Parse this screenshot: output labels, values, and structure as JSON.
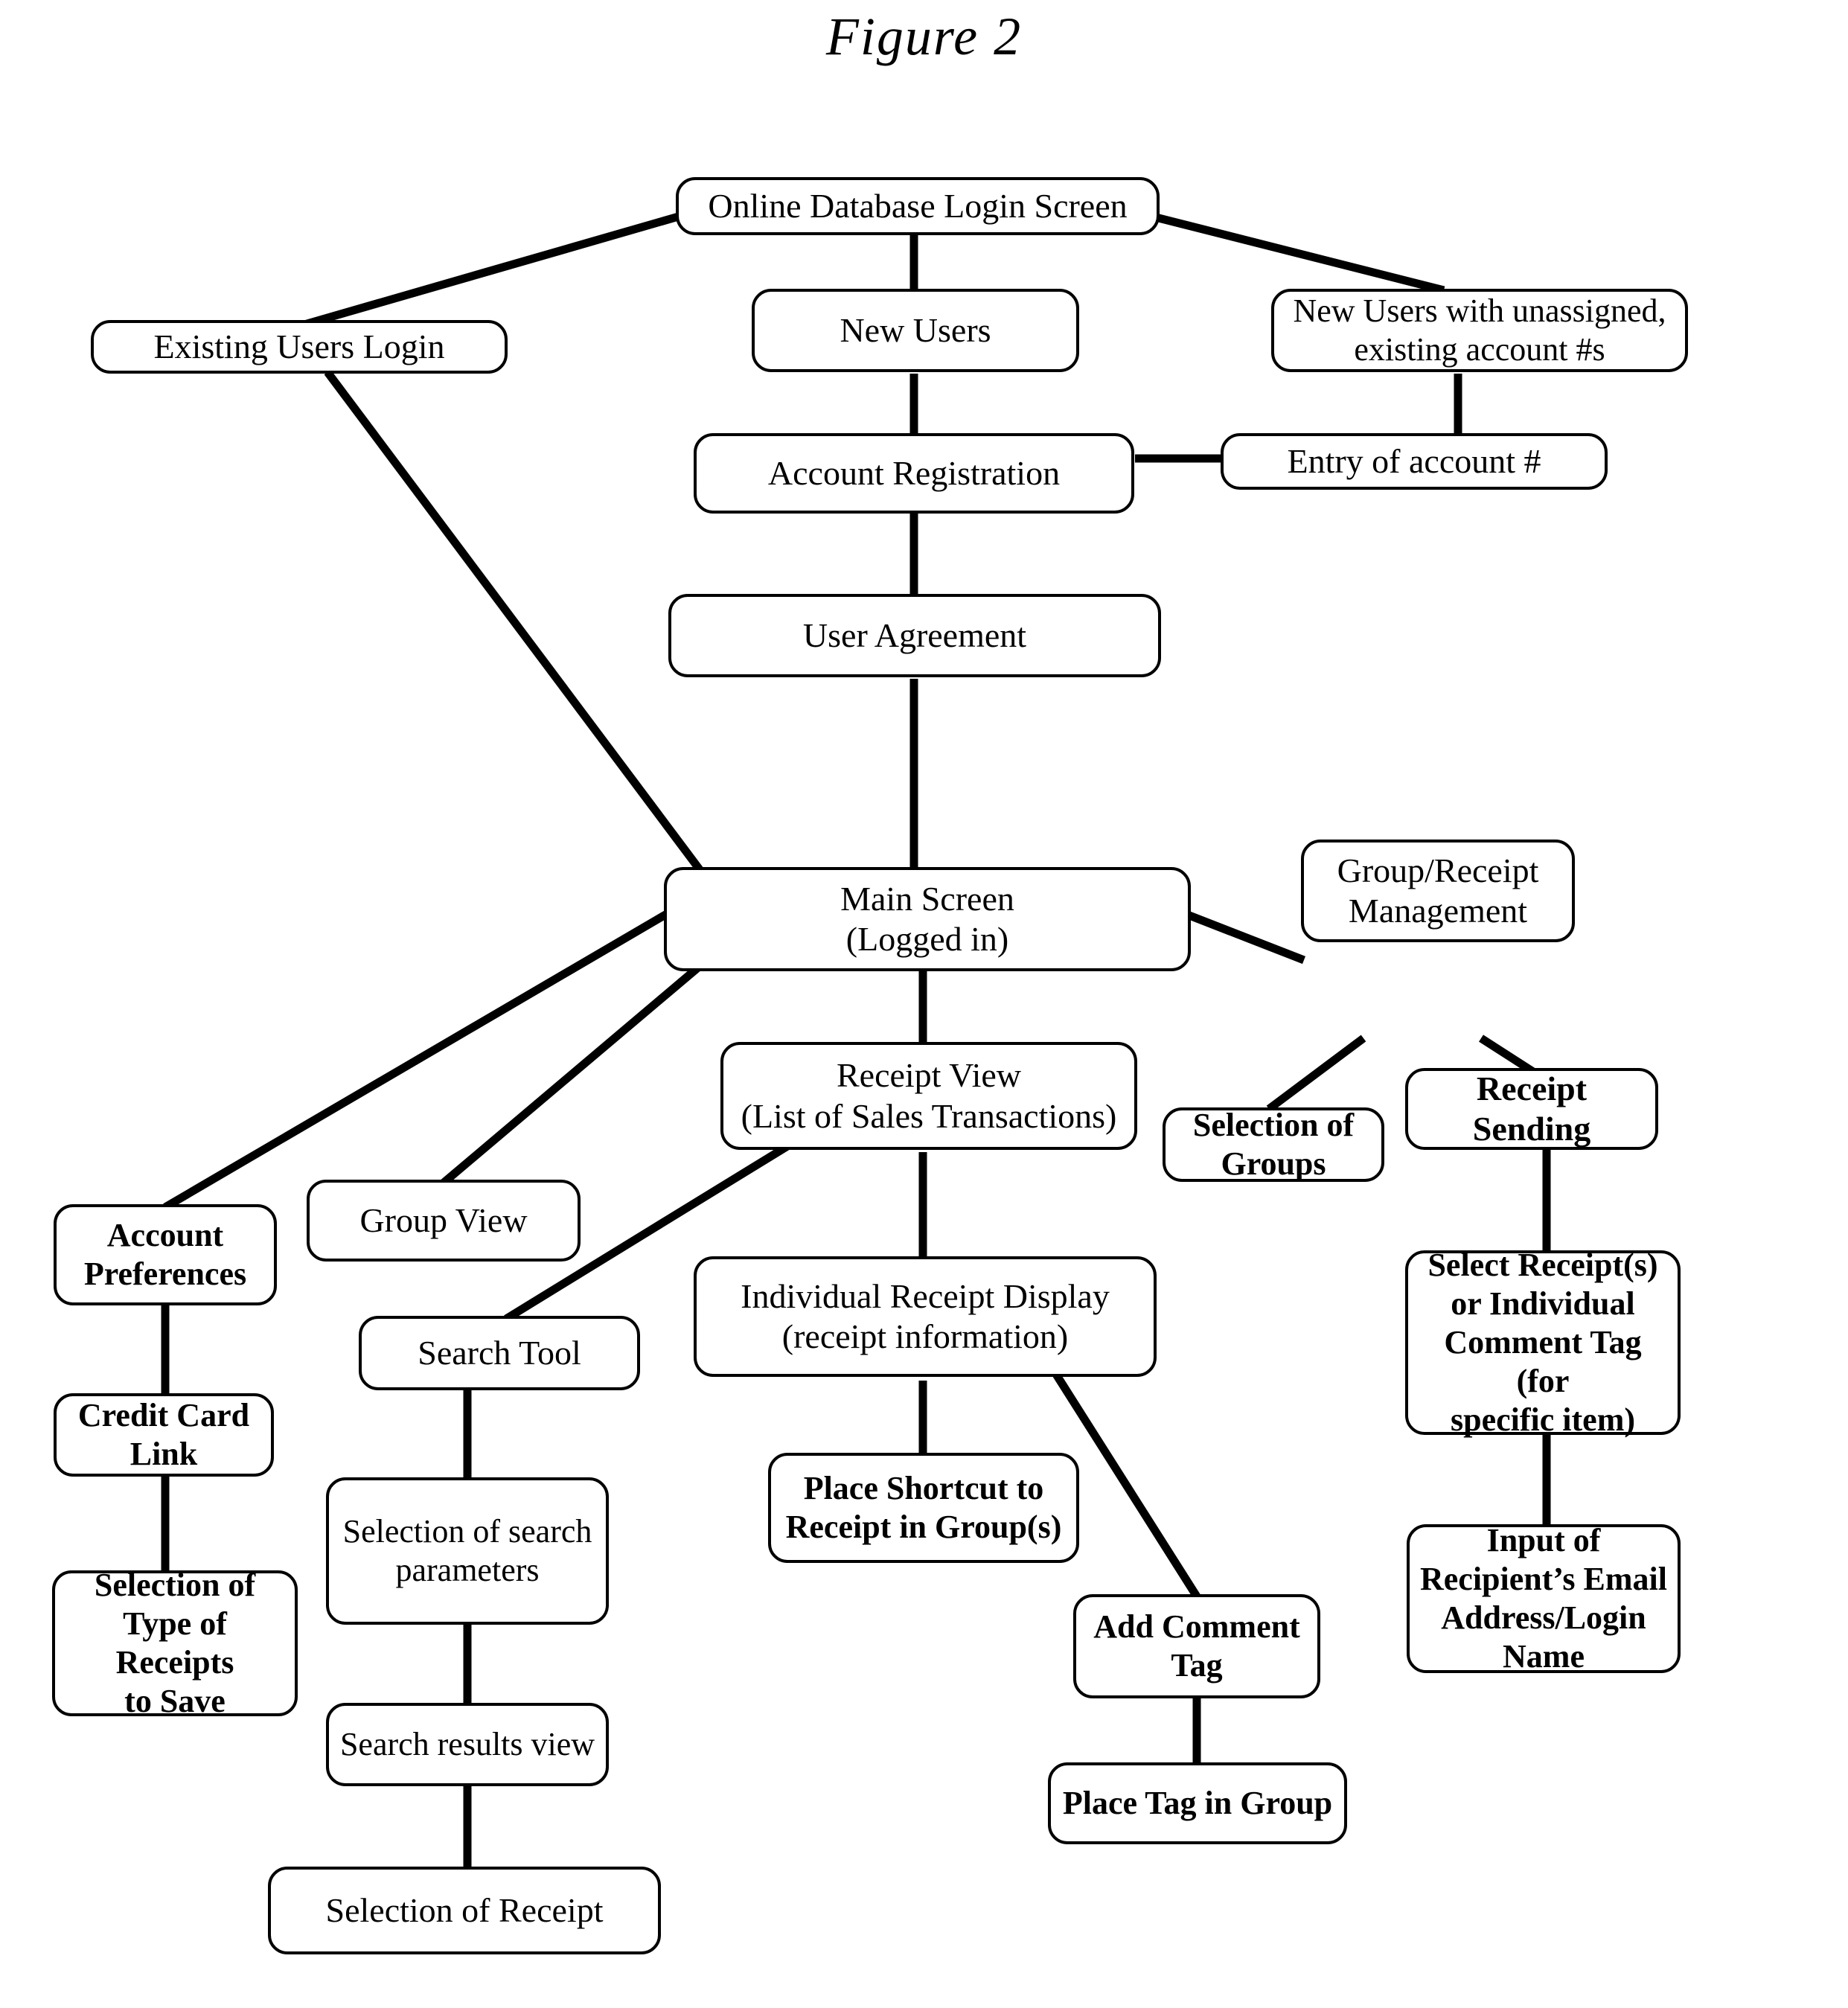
{
  "figure": {
    "title": "Figure 2"
  },
  "diagram_data": {
    "type": "flowchart",
    "title": "Figure 2",
    "orientation": "top-down",
    "node_shape": "rounded-rectangle",
    "nodes": [
      {
        "id": "login_screen",
        "label": "Online Database Login Screen"
      },
      {
        "id": "existing_users",
        "label": "Existing Users Login"
      },
      {
        "id": "new_users",
        "label": "New Users"
      },
      {
        "id": "new_users_unassigned",
        "label": "New Users with unassigned, existing account #s"
      },
      {
        "id": "account_registration",
        "label": "Account Registration"
      },
      {
        "id": "entry_account",
        "label": "Entry of account #"
      },
      {
        "id": "user_agreement",
        "label": "User Agreement"
      },
      {
        "id": "main_screen",
        "label": "Main Screen (Logged in)"
      },
      {
        "id": "group_receipt_mgmt",
        "label": "Group/Receipt Management"
      },
      {
        "id": "receipt_view",
        "label": "Receipt View (List of Sales Transactions)"
      },
      {
        "id": "selection_groups",
        "label": "Selection of Groups"
      },
      {
        "id": "receipt_sending",
        "label": "Receipt Sending"
      },
      {
        "id": "account_preferences",
        "label": "Account Preferences"
      },
      {
        "id": "group_view",
        "label": "Group View"
      },
      {
        "id": "search_tool",
        "label": "Search Tool"
      },
      {
        "id": "individual_receipt",
        "label": "Individual Receipt Display (receipt information)"
      },
      {
        "id": "select_receipts",
        "label": "Select Receipt(s) or Individual Comment Tag (for specific item)"
      },
      {
        "id": "credit_card_link",
        "label": "Credit Card Link"
      },
      {
        "id": "selection_search_params",
        "label": "Selection of search parameters"
      },
      {
        "id": "place_shortcut",
        "label": "Place Shortcut to Receipt in Group(s)"
      },
      {
        "id": "selection_type_receipts",
        "label": "Selection of Type of Receipts to Save"
      },
      {
        "id": "add_comment_tag",
        "label": "Add Comment Tag"
      },
      {
        "id": "input_recipient",
        "label": "Input of Recipient's Email Address/Login Name"
      },
      {
        "id": "search_results_view",
        "label": "Search results view"
      },
      {
        "id": "place_tag_group",
        "label": "Place Tag in Group"
      },
      {
        "id": "selection_receipt",
        "label": "Selection of Receipt"
      }
    ],
    "edges": [
      {
        "from": "login_screen",
        "to": "existing_users"
      },
      {
        "from": "login_screen",
        "to": "new_users"
      },
      {
        "from": "login_screen",
        "to": "new_users_unassigned"
      },
      {
        "from": "new_users",
        "to": "account_registration"
      },
      {
        "from": "new_users_unassigned",
        "to": "entry_account"
      },
      {
        "from": "account_registration",
        "to": "entry_account"
      },
      {
        "from": "account_registration",
        "to": "user_agreement"
      },
      {
        "from": "user_agreement",
        "to": "main_screen"
      },
      {
        "from": "existing_users",
        "to": "main_screen"
      },
      {
        "from": "main_screen",
        "to": "group_receipt_mgmt"
      },
      {
        "from": "main_screen",
        "to": "receipt_view"
      },
      {
        "from": "main_screen",
        "to": "account_preferences"
      },
      {
        "from": "main_screen",
        "to": "group_view"
      },
      {
        "from": "group_receipt_mgmt",
        "to": "selection_groups"
      },
      {
        "from": "group_receipt_mgmt",
        "to": "receipt_sending"
      },
      {
        "from": "receipt_view",
        "to": "search_tool"
      },
      {
        "from": "receipt_view",
        "to": "individual_receipt"
      },
      {
        "from": "receipt_sending",
        "to": "select_receipts"
      },
      {
        "from": "account_preferences",
        "to": "credit_card_link"
      },
      {
        "from": "search_tool",
        "to": "selection_search_params"
      },
      {
        "from": "individual_receipt",
        "to": "place_shortcut"
      },
      {
        "from": "individual_receipt",
        "to": "add_comment_tag"
      },
      {
        "from": "credit_card_link",
        "to": "selection_type_receipts"
      },
      {
        "from": "select_receipts",
        "to": "input_recipient"
      },
      {
        "from": "selection_search_params",
        "to": "search_results_view"
      },
      {
        "from": "add_comment_tag",
        "to": "place_tag_group"
      },
      {
        "from": "search_results_view",
        "to": "selection_receipt"
      }
    ]
  },
  "nodes": {
    "login_screen": {
      "line1": "Online Database Login Screen"
    },
    "existing_users": {
      "line1": "Existing Users Login"
    },
    "new_users": {
      "line1": "New Users"
    },
    "new_users_unassigned": {
      "line1": "New Users with unassigned,",
      "line2": "existing account #s"
    },
    "account_registration": {
      "line1": "Account Registration"
    },
    "entry_account": {
      "line1": "Entry of account #"
    },
    "user_agreement": {
      "line1": "User Agreement"
    },
    "main_screen": {
      "line1": "Main Screen",
      "line2": "(Logged in)"
    },
    "group_receipt_mgmt": {
      "line1": "Group/Receipt",
      "line2": "Management"
    },
    "receipt_view": {
      "line1": "Receipt View",
      "line2": "(List of Sales Transactions)"
    },
    "selection_groups": {
      "line1": "Selection of",
      "line2": "Groups"
    },
    "receipt_sending": {
      "line1": "Receipt Sending"
    },
    "account_preferences": {
      "line1": "Account",
      "line2": "Preferences"
    },
    "group_view": {
      "line1": "Group View"
    },
    "search_tool": {
      "line1": "Search Tool"
    },
    "individual_receipt": {
      "line1": "Individual Receipt Display",
      "line2": "(receipt information)"
    },
    "select_receipts": {
      "line1": "Select Receipt(s)",
      "line2": "or Individual",
      "line3": "Comment Tag (for",
      "line4": "specific item)"
    },
    "credit_card_link": {
      "line1": "Credit Card",
      "line2": "Link"
    },
    "selection_search_params": {
      "line1": "Selection of search",
      "line2": "parameters"
    },
    "place_shortcut": {
      "line1": "Place Shortcut to",
      "line2": "Receipt in Group(s)"
    },
    "selection_type_receipts": {
      "line1": "Selection of",
      "line2": "Type of Receipts",
      "line3": "to Save"
    },
    "add_comment_tag": {
      "line1": "Add Comment",
      "line2": "Tag"
    },
    "input_recipient": {
      "line1": "Input of",
      "line2": "Recipient’s Email",
      "line3": "Address/Login",
      "line4": "Name"
    },
    "search_results_view": {
      "line1": "Search results view"
    },
    "place_tag_group": {
      "line1": "Place Tag in Group"
    },
    "selection_receipt": {
      "line1": "Selection of Receipt"
    }
  },
  "colors": {
    "ink": "#000000",
    "paper": "#ffffff"
  }
}
